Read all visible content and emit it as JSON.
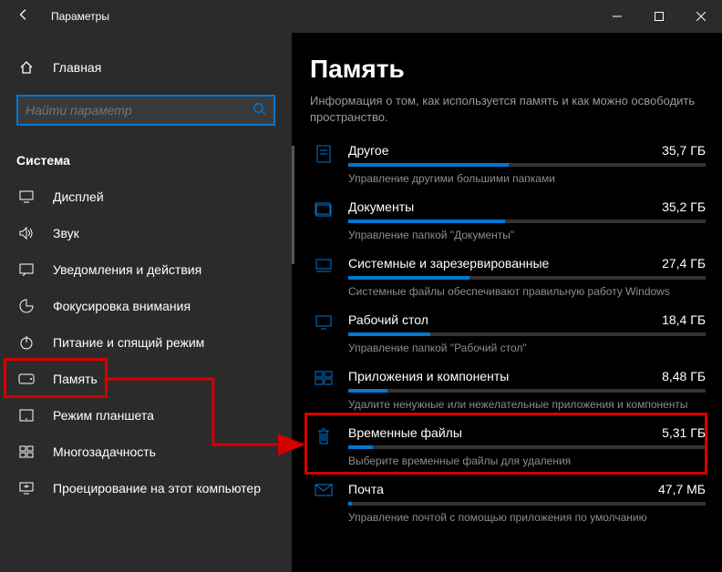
{
  "titlebar": {
    "title": "Параметры"
  },
  "sidebar": {
    "home": "Главная",
    "search_placeholder": "Найти параметр",
    "category": "Система",
    "items": [
      {
        "icon": "display",
        "label": "Дисплей"
      },
      {
        "icon": "sound",
        "label": "Звук"
      },
      {
        "icon": "notifications",
        "label": "Уведомления и действия"
      },
      {
        "icon": "focus",
        "label": "Фокусировка внимания"
      },
      {
        "icon": "power",
        "label": "Питание и спящий режим"
      },
      {
        "icon": "storage",
        "label": "Память"
      },
      {
        "icon": "tablet",
        "label": "Режим планшета"
      },
      {
        "icon": "multitask",
        "label": "Многозадачность"
      },
      {
        "icon": "project",
        "label": "Проецирование на этот компьютер"
      }
    ]
  },
  "main": {
    "heading": "Память",
    "intro": "Информация о том, как используется память и как можно освободить пространство.",
    "items": [
      {
        "icon": "other",
        "name": "Другое",
        "size": "35,7 ГБ",
        "pct": 45,
        "desc": "Управление другими большими папками"
      },
      {
        "icon": "documents",
        "name": "Документы",
        "size": "35,2 ГБ",
        "pct": 44,
        "desc": "Управление папкой \"Документы\""
      },
      {
        "icon": "system",
        "name": "Системные и зарезервированные",
        "size": "27,4 ГБ",
        "pct": 34,
        "desc": "Системные файлы обеспечивают правильную работу Windows"
      },
      {
        "icon": "desktop",
        "name": "Рабочий стол",
        "size": "18,4 ГБ",
        "pct": 23,
        "desc": "Управление папкой \"Рабочий стол\""
      },
      {
        "icon": "apps",
        "name": "Приложения и компоненты",
        "size": "8,48 ГБ",
        "pct": 11,
        "desc": "Удалите ненужные или нежелательные приложения и компоненты"
      },
      {
        "icon": "temp",
        "name": "Временные файлы",
        "size": "5,31 ГБ",
        "pct": 7,
        "desc": "Выберите временные файлы для удаления"
      },
      {
        "icon": "mail",
        "name": "Почта",
        "size": "47,7 МБ",
        "pct": 1,
        "desc": "Управление почтой с помощью приложения по умолчанию"
      }
    ]
  }
}
